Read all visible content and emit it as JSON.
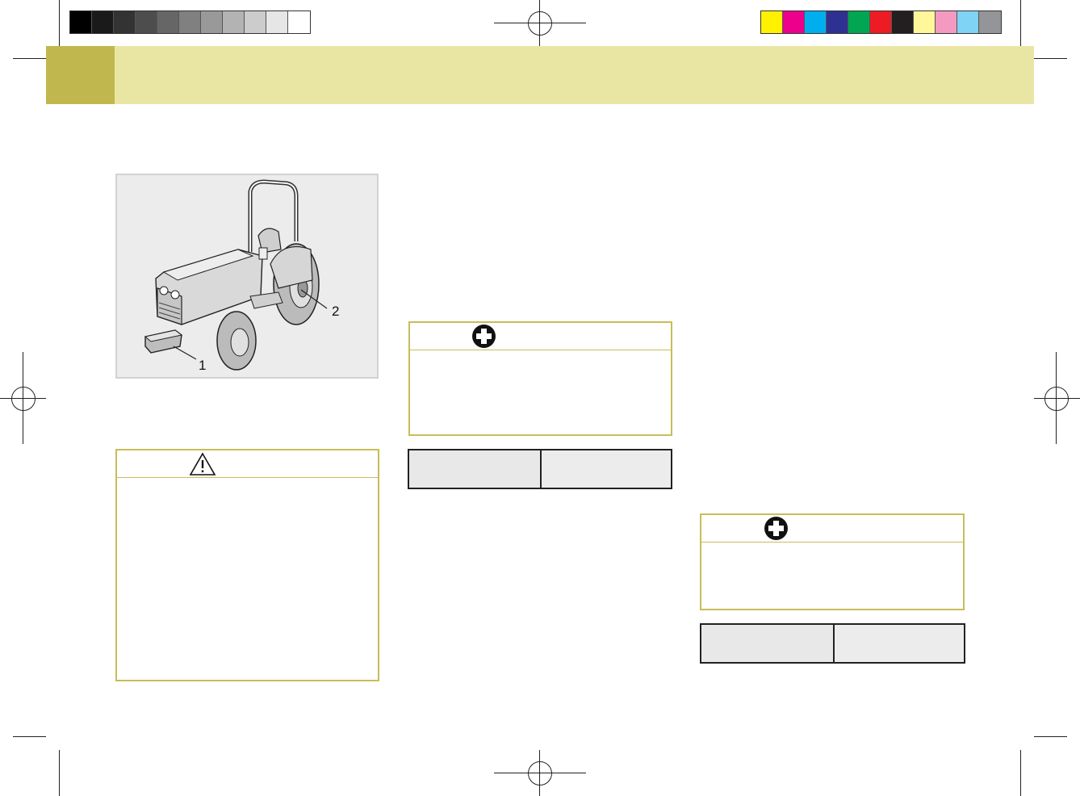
{
  "colors": {
    "header_band": "#e9e6a4",
    "header_tab": "#c0b84e",
    "box_border": "#c8bd5a",
    "gray_bar": [
      "#000000",
      "#1a1a1a",
      "#333333",
      "#4d4d4d",
      "#666666",
      "#808080",
      "#999999",
      "#b3b3b3",
      "#cccccc",
      "#e6e6e6",
      "#ffffff"
    ],
    "color_bar": [
      "#fff200",
      "#ec008c",
      "#00aeef",
      "#2e3192",
      "#00a651",
      "#ed1c24",
      "#231f20",
      "#fff799",
      "#f49ac1",
      "#7fd3f5",
      "#939598"
    ]
  },
  "figure": {
    "callouts": [
      "1",
      "2"
    ],
    "subject": "tractor-illustration"
  },
  "warning_box": {
    "icon": "warning-triangle-icon"
  },
  "notice_boxes": [
    {
      "icon": "plus-circle-icon"
    },
    {
      "icon": "plus-circle-icon"
    }
  ]
}
